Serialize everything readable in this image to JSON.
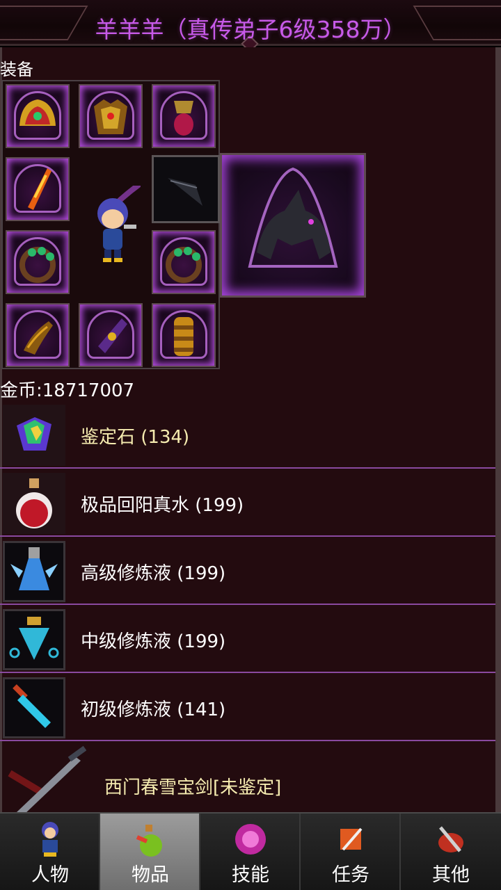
{
  "header": {
    "title": "羊羊羊（真传弟子6级358万）"
  },
  "equipment": {
    "section_label": "装备",
    "slots": [
      {
        "icon": "helmet-icon"
      },
      {
        "icon": "armor-icon"
      },
      {
        "icon": "amulet-icon"
      },
      {
        "icon": "weapon-icon"
      },
      {
        "icon": "ring-left-icon"
      },
      {
        "icon": "ring-right-icon"
      },
      {
        "icon": "boots-icon"
      },
      {
        "icon": "belt-icon"
      },
      {
        "icon": "bracer-icon"
      }
    ],
    "hero_icon": "hero-character-icon",
    "wing_icon": "wing-slot-icon",
    "mount_icon": "black-beast-mount-icon"
  },
  "gold": {
    "text": "金币:18717007"
  },
  "items": [
    {
      "label": "鉴定石 (134)",
      "icon": "rainbow-gem-icon",
      "color": "#f6ecb0"
    },
    {
      "label": "极品回阳真水 (199)",
      "icon": "red-potion-icon",
      "color": "#ffffff"
    },
    {
      "label": "高级修炼液 (199)",
      "icon": "blue-flask-icon",
      "color": "#ffffff"
    },
    {
      "label": "中级修炼液 (199)",
      "icon": "cyan-flask-icon",
      "color": "#ffffff"
    },
    {
      "label": "初级修炼液 (141)",
      "icon": "vial-icon",
      "color": "#ffffff"
    },
    {
      "label": "西门春雪宝剑[未鉴定]",
      "icon": "sword-icon",
      "color": "#f6ecb0"
    }
  ],
  "nav": {
    "tabs": [
      {
        "label": "人物",
        "icon": "character-icon",
        "active": false
      },
      {
        "label": "物品",
        "icon": "potion-bag-icon",
        "active": true
      },
      {
        "label": "技能",
        "icon": "skill-orb-icon",
        "active": false
      },
      {
        "label": "任务",
        "icon": "quest-scroll-icon",
        "active": false
      },
      {
        "label": "其他",
        "icon": "other-tools-icon",
        "active": false
      }
    ]
  },
  "colors": {
    "title": "#c75ae8",
    "accent": "#b44ce0",
    "row_divider": "#8a4aa0",
    "item_highlight": "#f6ecb0"
  }
}
